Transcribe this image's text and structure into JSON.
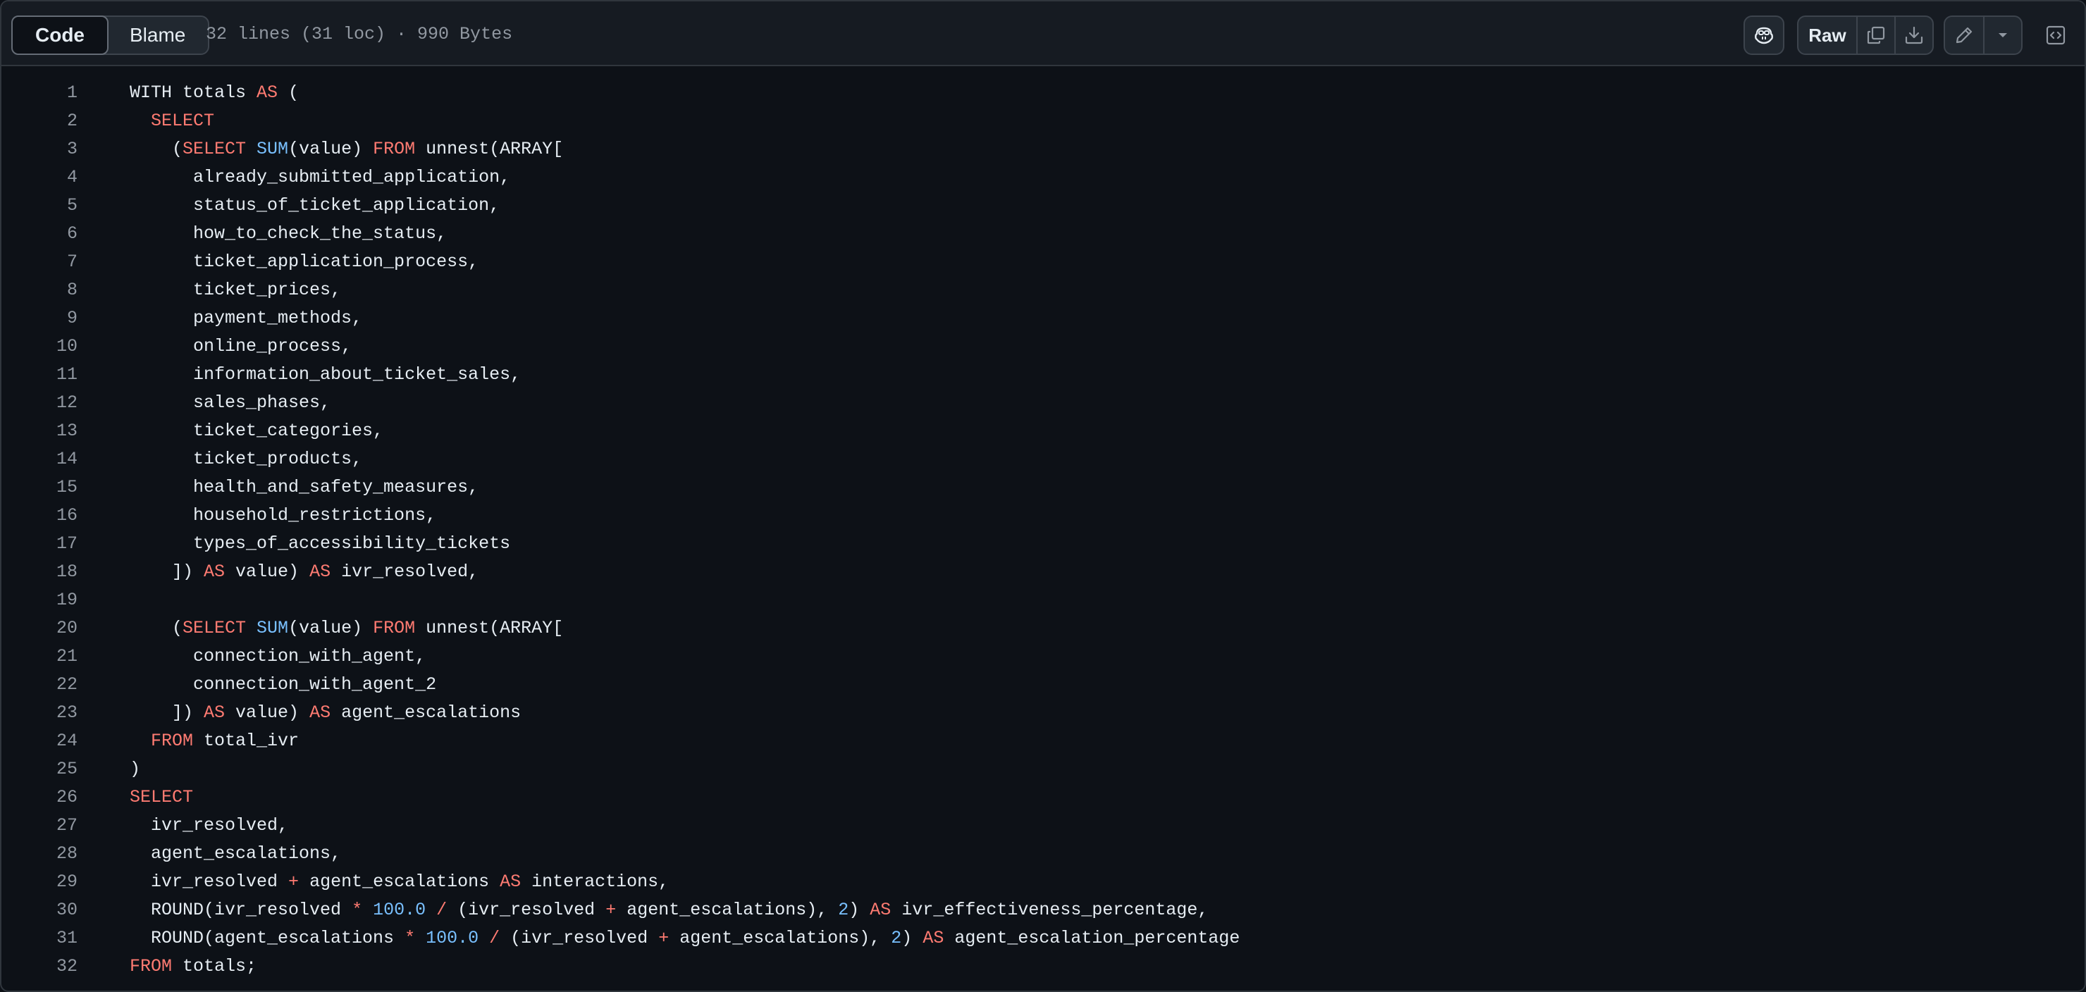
{
  "header": {
    "tabs": [
      {
        "label": "Code",
        "active": true
      },
      {
        "label": "Blame",
        "active": false
      }
    ],
    "file_info": "32 lines (31 loc) · 990 Bytes",
    "raw_label": "Raw",
    "icons": {
      "copilot": "copilot-icon",
      "copy": "copy-icon",
      "download": "download-icon",
      "edit": "pencil-icon",
      "edit_dropdown": "triangle-down-icon",
      "symbols": "code-square-icon"
    }
  },
  "colors": {
    "background": "#0d1117",
    "header_background": "#161b22",
    "border": "#30363d",
    "text": "#e6edf3",
    "muted": "#9198a1",
    "keyword": "#ff7b72",
    "function": "#79c0ff",
    "number": "#79c0ff"
  },
  "code": {
    "lines": [
      {
        "n": "1",
        "tokens": [
          {
            "t": "WITH totals "
          },
          {
            "t": "AS",
            "c": "kw"
          },
          {
            "t": " ("
          }
        ]
      },
      {
        "n": "2",
        "tokens": [
          {
            "t": "  "
          },
          {
            "t": "SELECT",
            "c": "kw"
          }
        ]
      },
      {
        "n": "3",
        "tokens": [
          {
            "t": "    ("
          },
          {
            "t": "SELECT",
            "c": "kw"
          },
          {
            "t": " "
          },
          {
            "t": "SUM",
            "c": "fn"
          },
          {
            "t": "(value) "
          },
          {
            "t": "FROM",
            "c": "kw"
          },
          {
            "t": " unnest(ARRAY["
          }
        ]
      },
      {
        "n": "4",
        "tokens": [
          {
            "t": "      already_submitted_application,"
          }
        ]
      },
      {
        "n": "5",
        "tokens": [
          {
            "t": "      status_of_ticket_application,"
          }
        ]
      },
      {
        "n": "6",
        "tokens": [
          {
            "t": "      how_to_check_the_status,"
          }
        ]
      },
      {
        "n": "7",
        "tokens": [
          {
            "t": "      ticket_application_process,"
          }
        ]
      },
      {
        "n": "8",
        "tokens": [
          {
            "t": "      ticket_prices,"
          }
        ]
      },
      {
        "n": "9",
        "tokens": [
          {
            "t": "      payment_methods,"
          }
        ]
      },
      {
        "n": "10",
        "tokens": [
          {
            "t": "      online_process,"
          }
        ]
      },
      {
        "n": "11",
        "tokens": [
          {
            "t": "      information_about_ticket_sales,"
          }
        ]
      },
      {
        "n": "12",
        "tokens": [
          {
            "t": "      sales_phases,"
          }
        ]
      },
      {
        "n": "13",
        "tokens": [
          {
            "t": "      ticket_categories,"
          }
        ]
      },
      {
        "n": "14",
        "tokens": [
          {
            "t": "      ticket_products,"
          }
        ]
      },
      {
        "n": "15",
        "tokens": [
          {
            "t": "      health_and_safety_measures,"
          }
        ]
      },
      {
        "n": "16",
        "tokens": [
          {
            "t": "      household_restrictions,"
          }
        ]
      },
      {
        "n": "17",
        "tokens": [
          {
            "t": "      types_of_accessibility_tickets"
          }
        ]
      },
      {
        "n": "18",
        "tokens": [
          {
            "t": "    ]) "
          },
          {
            "t": "AS",
            "c": "kw"
          },
          {
            "t": " value) "
          },
          {
            "t": "AS",
            "c": "kw"
          },
          {
            "t": " ivr_resolved,"
          }
        ]
      },
      {
        "n": "19",
        "tokens": [
          {
            "t": ""
          }
        ]
      },
      {
        "n": "20",
        "tokens": [
          {
            "t": "    ("
          },
          {
            "t": "SELECT",
            "c": "kw"
          },
          {
            "t": " "
          },
          {
            "t": "SUM",
            "c": "fn"
          },
          {
            "t": "(value) "
          },
          {
            "t": "FROM",
            "c": "kw"
          },
          {
            "t": " unnest(ARRAY["
          }
        ]
      },
      {
        "n": "21",
        "tokens": [
          {
            "t": "      connection_with_agent,"
          }
        ]
      },
      {
        "n": "22",
        "tokens": [
          {
            "t": "      connection_with_agent_2"
          }
        ]
      },
      {
        "n": "23",
        "tokens": [
          {
            "t": "    ]) "
          },
          {
            "t": "AS",
            "c": "kw"
          },
          {
            "t": " value) "
          },
          {
            "t": "AS",
            "c": "kw"
          },
          {
            "t": " agent_escalations"
          }
        ]
      },
      {
        "n": "24",
        "tokens": [
          {
            "t": "  "
          },
          {
            "t": "FROM",
            "c": "kw"
          },
          {
            "t": " total_ivr"
          }
        ]
      },
      {
        "n": "25",
        "tokens": [
          {
            "t": ")"
          }
        ]
      },
      {
        "n": "26",
        "tokens": [
          {
            "t": "SELECT",
            "c": "kw"
          }
        ]
      },
      {
        "n": "27",
        "tokens": [
          {
            "t": "  ivr_resolved,"
          }
        ]
      },
      {
        "n": "28",
        "tokens": [
          {
            "t": "  agent_escalations,"
          }
        ]
      },
      {
        "n": "29",
        "tokens": [
          {
            "t": "  ivr_resolved "
          },
          {
            "t": "+",
            "c": "op"
          },
          {
            "t": " agent_escalations "
          },
          {
            "t": "AS",
            "c": "kw"
          },
          {
            "t": " interactions,"
          }
        ]
      },
      {
        "n": "30",
        "tokens": [
          {
            "t": "  ROUND(ivr_resolved "
          },
          {
            "t": "*",
            "c": "op"
          },
          {
            "t": " "
          },
          {
            "t": "100.0",
            "c": "num"
          },
          {
            "t": " "
          },
          {
            "t": "/",
            "c": "op"
          },
          {
            "t": " (ivr_resolved "
          },
          {
            "t": "+",
            "c": "op"
          },
          {
            "t": " agent_escalations), "
          },
          {
            "t": "2",
            "c": "num"
          },
          {
            "t": ") "
          },
          {
            "t": "AS",
            "c": "kw"
          },
          {
            "t": " ivr_effectiveness_percentage,"
          }
        ]
      },
      {
        "n": "31",
        "tokens": [
          {
            "t": "  ROUND(agent_escalations "
          },
          {
            "t": "*",
            "c": "op"
          },
          {
            "t": " "
          },
          {
            "t": "100.0",
            "c": "num"
          },
          {
            "t": " "
          },
          {
            "t": "/",
            "c": "op"
          },
          {
            "t": " (ivr_resolved "
          },
          {
            "t": "+",
            "c": "op"
          },
          {
            "t": " agent_escalations), "
          },
          {
            "t": "2",
            "c": "num"
          },
          {
            "t": ") "
          },
          {
            "t": "AS",
            "c": "kw"
          },
          {
            "t": " agent_escalation_percentage"
          }
        ]
      },
      {
        "n": "32",
        "tokens": [
          {
            "t": "FROM",
            "c": "kw"
          },
          {
            "t": " totals;"
          }
        ]
      }
    ]
  }
}
